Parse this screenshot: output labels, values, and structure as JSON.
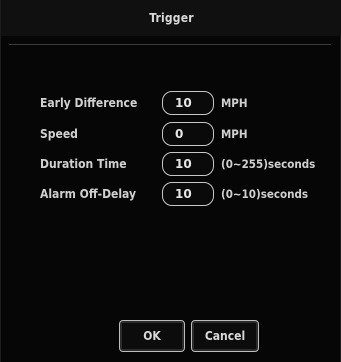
{
  "dialog": {
    "title": "Trigger"
  },
  "fields": [
    {
      "label": "Early Difference",
      "value": "10",
      "unit": "MPH"
    },
    {
      "label": "Speed",
      "value": "0",
      "unit": "MPH"
    },
    {
      "label": "Duration Time",
      "value": "10",
      "unit": "(0~255)seconds"
    },
    {
      "label": "Alarm Off-Delay",
      "value": "10",
      "unit": "(0~10)seconds"
    }
  ],
  "buttons": {
    "ok_label": "OK",
    "cancel_label": "Cancel"
  }
}
